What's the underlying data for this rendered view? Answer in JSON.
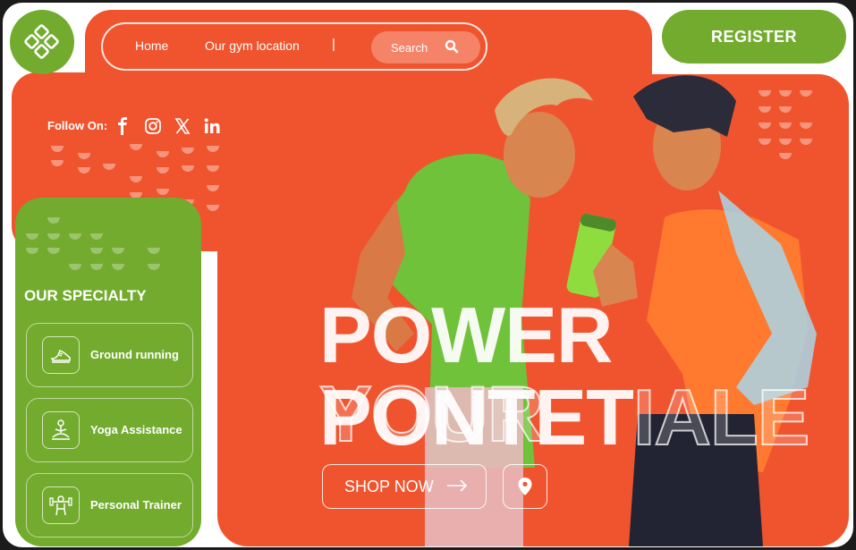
{
  "nav": {
    "home": "Home",
    "location": "Our gym location",
    "separator": "|",
    "search_label": "Search"
  },
  "register_label": "REGISTER",
  "social": {
    "follow_label": "Follow On:",
    "icons": [
      "facebook-icon",
      "instagram-icon",
      "x-icon",
      "linkedin-icon"
    ]
  },
  "specialty": {
    "title": "OUR SPECIALTY",
    "items": [
      {
        "label": "Ground running",
        "icon": "running-shoe-icon"
      },
      {
        "label": "Yoga Assistance",
        "icon": "yoga-icon"
      },
      {
        "label": "Personal Trainer",
        "icon": "trainer-icon"
      }
    ]
  },
  "hero": {
    "line1_solid": "POWER",
    "line1_outline": " YOUR",
    "line2_solid": "PONTET",
    "line2_outline": "IALE",
    "shop_label": "SHOP NOW"
  },
  "colors": {
    "orange": "#f0542e",
    "green": "#72ab2d",
    "white": "#ffffff"
  }
}
